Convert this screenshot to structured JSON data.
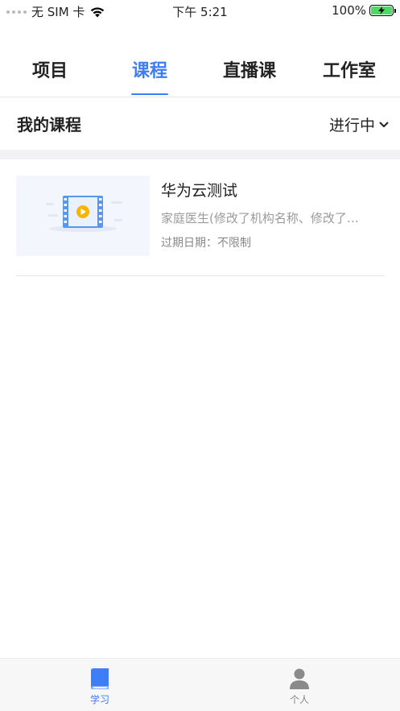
{
  "status_bar": {
    "carrier": "无 SIM 卡",
    "time": "下午 5:21",
    "battery": "100%"
  },
  "tabs": [
    {
      "label": "项目",
      "active": false
    },
    {
      "label": "课程",
      "active": true
    },
    {
      "label": "直播课",
      "active": false
    },
    {
      "label": "工作室",
      "active": false
    }
  ],
  "section": {
    "title": "我的课程",
    "filter_label": "进行中"
  },
  "courses": [
    {
      "title": "华为云测试",
      "subtitle": "家庭医生(修改了机构名称、修改了…",
      "expire": "过期日期：不限制"
    }
  ],
  "bottom_nav": [
    {
      "label": "学习",
      "active": true
    },
    {
      "label": "个人",
      "active": false
    }
  ],
  "colors": {
    "accent": "#3d7df5",
    "battery": "#4cd964"
  }
}
